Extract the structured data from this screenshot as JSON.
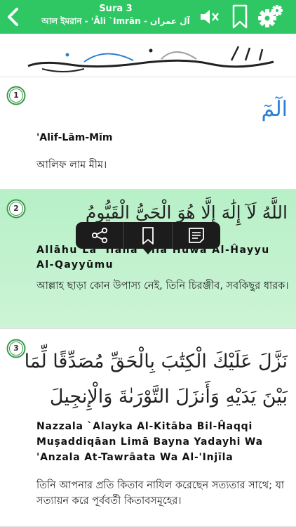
{
  "header": {
    "title": "Sura 3",
    "subtitle": "আল ইমরান - 'Āli `Imrān - آل عمران"
  },
  "bismillah": "بِسْمِ اللَّهِ الرَّحْمَٰنِ الرَّحِيمِ",
  "verses": [
    {
      "number": "1",
      "arabic": "الٓمٓ",
      "translit": "'Alif-Lām-Mīm",
      "translation": "আলিফ লাম মীম।"
    },
    {
      "number": "2",
      "arabic": "اللَّهُ لَآ إِلَٰهَ إِلَّا هُوَ الْحَىُّ الْقَيُّومُ",
      "translit": "Allāhu Lā 'Ilāha 'Illā Huwa Al-Ĥayyu Al-Qayyūmu",
      "translation": "আল্লাহ ছাড়া কোন উপাস্য নেই, তিনি চিরঞ্জীব, সবকিছুর ধারক।"
    },
    {
      "number": "3",
      "arabic": "نَزَّلَ عَلَيْكَ الْكِتَٰبَ بِالْحَقِّ مُصَدِّقًا لِّمَا بَيْنَ يَدَيْهِ وَأَنزَلَ التَّوْرَىٰةَ وَالْإِنجِيلَ",
      "translit": "Nazzala `Alayka Al-Kitāba Bil-Ĥaqqi Muşaddiqāan Limā Bayna Yadayhi Wa 'Anzala At-Tawrāata Wa Al-'Injīla",
      "translation": "তিনি আপনার প্রতি কিতাব নাযিল করেছেন সত্যতার সাথে; যা সত্যায়ন করে পূর্ববর্তী কিতাবসমূহের।"
    }
  ],
  "colors": {
    "header": "#2fc764",
    "highlight": "#b7f0c7",
    "tajweed_blue": "#2a7fd4",
    "tajweed_gray": "#a0a0a0",
    "tajweed_purple": "#9b2fa8"
  },
  "icons": [
    "back-chevron-icon",
    "speaker-muted-icon",
    "bookmark-icon",
    "settings-gear-icon",
    "share-icon",
    "note-icon"
  ]
}
